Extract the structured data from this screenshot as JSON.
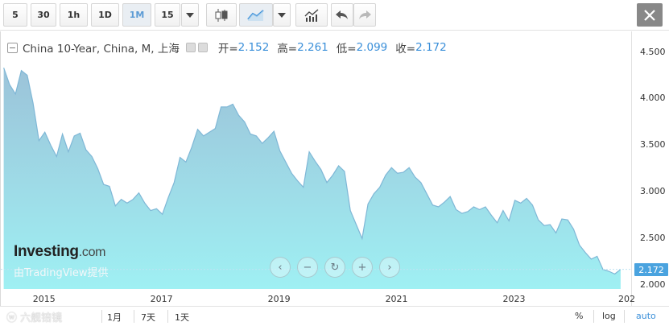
{
  "toolbar": {
    "intervals": [
      "5",
      "30",
      "1h",
      "1D",
      "1M",
      "15"
    ],
    "active_interval": "1M"
  },
  "legend": {
    "title": "China 10-Year, China, M, 上海",
    "open_label": "开=",
    "open_value": "2.152",
    "high_label": "高=",
    "high_value": "2.261",
    "low_label": "低=",
    "low_value": "2.099",
    "close_label": "收=",
    "close_value": "2.172"
  },
  "price_tag": "2.172",
  "watermark": {
    "brand": "Investing",
    "brand_suffix": ".com",
    "sub": "由TradingView提供"
  },
  "bottom": {
    "ranges": [
      "1月",
      "7天",
      "1天"
    ],
    "percent": "%",
    "log": "log",
    "auto": "auto",
    "overlay_text": "六舰锫镜"
  },
  "colors": {
    "line": "#7fb7d6",
    "fill_top": "#9cc3d9",
    "fill_bottom": "#9ff0f3",
    "accent": "#3a8fd9",
    "price_tag": "#4aa3df"
  },
  "chart_data": {
    "type": "area",
    "y_ticks": [
      "4.500",
      "4.000",
      "3.500",
      "3.000",
      "2.500",
      "2.000"
    ],
    "ylim": [
      1.96,
      4.72
    ],
    "x_ticks": [
      "2015",
      "2017",
      "2019",
      "2021",
      "2023",
      "202"
    ],
    "x_tick_values": [
      2015.0,
      2017.0,
      2019.0,
      2021.0,
      2023.0,
      2025.0
    ],
    "xlim": [
      2014.25,
      2024.98
    ],
    "x": [
      2014.3,
      2014.4,
      2014.5,
      2014.6,
      2014.7,
      2014.8,
      2014.9,
      2015.0,
      2015.1,
      2015.2,
      2015.3,
      2015.4,
      2015.5,
      2015.6,
      2015.7,
      2015.8,
      2015.9,
      2016.0,
      2016.1,
      2016.2,
      2016.3,
      2016.4,
      2016.5,
      2016.6,
      2016.7,
      2016.8,
      2016.9,
      2017.0,
      2017.1,
      2017.2,
      2017.3,
      2017.4,
      2017.5,
      2017.6,
      2017.7,
      2017.8,
      2017.9,
      2018.0,
      2018.1,
      2018.2,
      2018.3,
      2018.4,
      2018.5,
      2018.6,
      2018.7,
      2018.8,
      2018.9,
      2019.0,
      2019.1,
      2019.2,
      2019.3,
      2019.4,
      2019.5,
      2019.6,
      2019.7,
      2019.8,
      2019.9,
      2020.0,
      2020.1,
      2020.2,
      2020.3,
      2020.4,
      2020.5,
      2020.6,
      2020.7,
      2020.8,
      2020.9,
      2021.0,
      2021.1,
      2021.2,
      2021.3,
      2021.4,
      2021.5,
      2021.6,
      2021.7,
      2021.8,
      2021.9,
      2022.0,
      2022.1,
      2022.2,
      2022.3,
      2022.4,
      2022.5,
      2022.6,
      2022.7,
      2022.8,
      2022.9,
      2023.0,
      2023.1,
      2023.2,
      2023.3,
      2023.4,
      2023.5,
      2023.6,
      2023.7,
      2023.8,
      2023.9,
      2024.0,
      2024.1,
      2024.2,
      2024.3,
      2024.4,
      2024.5,
      2024.6,
      2024.7,
      2024.8
    ],
    "values": [
      4.33,
      4.15,
      4.05,
      4.3,
      4.25,
      3.95,
      3.55,
      3.64,
      3.5,
      3.38,
      3.62,
      3.43,
      3.6,
      3.63,
      3.45,
      3.38,
      3.25,
      3.08,
      3.06,
      2.85,
      2.92,
      2.88,
      2.92,
      2.99,
      2.88,
      2.8,
      2.82,
      2.76,
      2.94,
      3.1,
      3.37,
      3.32,
      3.48,
      3.67,
      3.6,
      3.64,
      3.68,
      3.91,
      3.91,
      3.94,
      3.82,
      3.75,
      3.62,
      3.6,
      3.52,
      3.58,
      3.65,
      3.44,
      3.32,
      3.2,
      3.12,
      3.05,
      3.43,
      3.33,
      3.24,
      3.1,
      3.18,
      3.28,
      3.22,
      2.8,
      2.65,
      2.5,
      2.87,
      2.98,
      3.05,
      3.18,
      3.26,
      3.2,
      3.21,
      3.26,
      3.16,
      3.1,
      2.98,
      2.86,
      2.84,
      2.89,
      2.95,
      2.81,
      2.77,
      2.79,
      2.84,
      2.81,
      2.84,
      2.75,
      2.67,
      2.8,
      2.69,
      2.91,
      2.88,
      2.93,
      2.86,
      2.7,
      2.64,
      2.65,
      2.56,
      2.71,
      2.7,
      2.6,
      2.43,
      2.35,
      2.28,
      2.31,
      2.17,
      2.15,
      2.12,
      2.17
    ]
  }
}
